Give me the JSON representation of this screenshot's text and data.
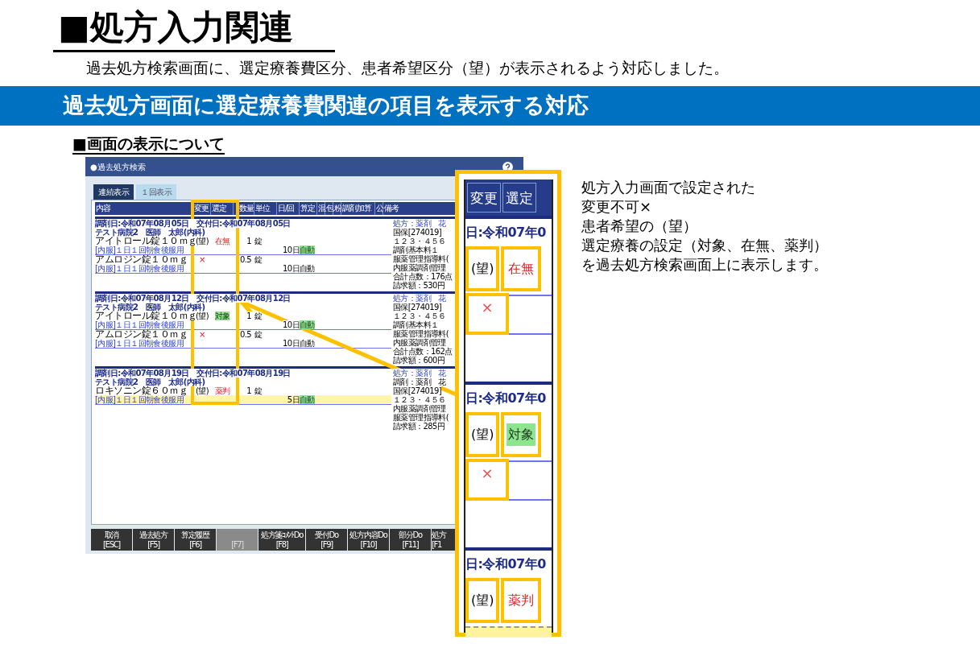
{
  "slide": {
    "title": "■処方入力関連",
    "subtitle": "過去処方検索画面に、選定療養費区分、患者希望区分（望）が表示されるよう対応しました。",
    "banner": "過去処方画面に選定療養費関連の項目を表示する対応",
    "section": "■画面の表示について",
    "note_lines": [
      "処方入力画面で設定された",
      "変更不可×",
      "患者希望の（望）",
      "選定療養の設定（対象、在無、薬判）",
      "を過去処方検索画面上に表示します。"
    ]
  },
  "window": {
    "title": "●過去処方検索",
    "tabs": [
      {
        "label": "連続表示",
        "selected": true
      },
      {
        "label": "１回表示",
        "selected": false
      }
    ],
    "columns": [
      "内容",
      "変更",
      "選定",
      "数量",
      "単位",
      "日/回",
      "算定",
      "混",
      "包",
      "粉",
      "調剤加算",
      "公",
      "備考"
    ],
    "records": [
      {
        "dates": "調剤日:令和07年08月05日　交付日:令和07年08月05日",
        "doctor": "テスト病院2　医師　太郎(内科)",
        "drugs": [
          {
            "name": "アイトロール錠１０ｍｇ",
            "change": {
              "kind": "hope",
              "text": "(望)"
            },
            "selection": {
              "text": "在無",
              "highlight": false
            },
            "quantity": "1",
            "unit": "錠",
            "usage": "[内服]１日１回朝食後服用",
            "days": "10日",
            "calc": "自動",
            "calc_highlight": true,
            "selected": false
          },
          {
            "name": "アムロジン錠１０ｍｇ",
            "change": {
              "kind": "cross",
              "text": "×"
            },
            "quantity": "0.5",
            "unit": "錠",
            "usage": "[内服]１日１回朝食後服用",
            "days": "10日",
            "calc": "自動",
            "calc_highlight": false,
            "selected": false
          }
        ],
        "remarks": [
          "処方：薬剤　花",
          "国保[274019]",
          "１２３・４５６",
          "調剤基本料１",
          "服薬管理指導料(",
          "内服薬調剤管理",
          "合計点数：176点",
          "請求額：530円"
        ]
      },
      {
        "dates": "調剤日:令和07年08月12日　交付日:令和07年08月12日",
        "doctor": "テスト病院2　医師　太郎(内科)",
        "drugs": [
          {
            "name": "アイトロール錠１０ｍｇ",
            "change": {
              "kind": "hope",
              "text": "(望)"
            },
            "selection": {
              "text": "対象",
              "highlight": true
            },
            "quantity": "1",
            "unit": "錠",
            "usage": "[内服]１日１回朝食後服用",
            "days": "10日",
            "calc": "自動",
            "calc_highlight": true,
            "selected": false
          },
          {
            "name": "アムロジン錠１０ｍｇ",
            "change": {
              "kind": "cross",
              "text": "×"
            },
            "quantity": "0.5",
            "unit": "錠",
            "usage": "[内服]１日１回朝食後服用",
            "days": "10日",
            "calc": "自動",
            "calc_highlight": false,
            "selected": false
          }
        ],
        "remarks": [
          "処方：薬剤　花",
          "国保[274019]",
          "１２３・４５６",
          "調剤基本料１",
          "服薬管理指導料(",
          "内服薬調剤管理",
          "合計点数：162点",
          "請求額：600円"
        ]
      },
      {
        "dates": "調剤日:令和07年08月19日　交付日:令和07年08月19日",
        "doctor": "テスト病院2　医師　太郎(内科)",
        "drugs": [
          {
            "name": "ロキソニン錠６０ｍｇ",
            "change": {
              "kind": "hope",
              "text": "(望)"
            },
            "selection": {
              "text": "薬判",
              "highlight": false
            },
            "quantity": "1",
            "unit": "錠",
            "usage": "[内服]１日１回朝食後服用",
            "days": "5日",
            "calc": "自動",
            "calc_highlight": true,
            "selected": true
          }
        ],
        "remarks": [
          "処方：薬剤　花",
          "調剤：薬剤　花",
          "国保[274019]",
          "１２３・４５６",
          "内服薬調剤管理",
          "服薬管理指導料(",
          "請求額：285円"
        ]
      }
    ],
    "function_keys": [
      {
        "label": "取消",
        "key": "[ESC]",
        "disabled": false
      },
      {
        "label": "過去処方",
        "key": "[F5]",
        "disabled": false
      },
      {
        "label": "算定履歴",
        "key": "[F6]",
        "disabled": false
      },
      {
        "key": "[F7]",
        "disabled": true
      },
      {
        "label": "処方箋ｺﾒﾝﾄDo",
        "key": "[F8]",
        "disabled": false
      },
      {
        "label": "受付Do",
        "key": "[F9]",
        "disabled": false
      },
      {
        "label": "処方内容Do",
        "key": "[F10]",
        "disabled": false
      },
      {
        "label": "部分Do",
        "key": "[F11]",
        "disabled": false
      },
      {
        "label": "処方",
        "key": "[F1",
        "disabled": false
      }
    ]
  },
  "zoom_inset": {
    "rows": [
      {
        "kind": "header",
        "cells": [
          "変更",
          "選定"
        ]
      },
      {
        "kind": "date",
        "text": "日:令和07年0"
      },
      {
        "kind": "pair",
        "change": "(望)",
        "selection": {
          "text": "在無",
          "highlight": false
        }
      },
      {
        "kind": "cross",
        "text": "×"
      },
      {
        "kind": "date",
        "text": "日:令和07年0"
      },
      {
        "kind": "pair",
        "change": "(望)",
        "selection": {
          "text": "対象",
          "highlight": true
        }
      },
      {
        "kind": "cross",
        "text": "×"
      },
      {
        "kind": "date",
        "text": "日:令和07年0"
      },
      {
        "kind": "pair",
        "change": "(望)",
        "selection": {
          "text": "薬判",
          "highlight": false
        }
      },
      {
        "kind": "usage",
        "selected": true
      }
    ]
  }
}
